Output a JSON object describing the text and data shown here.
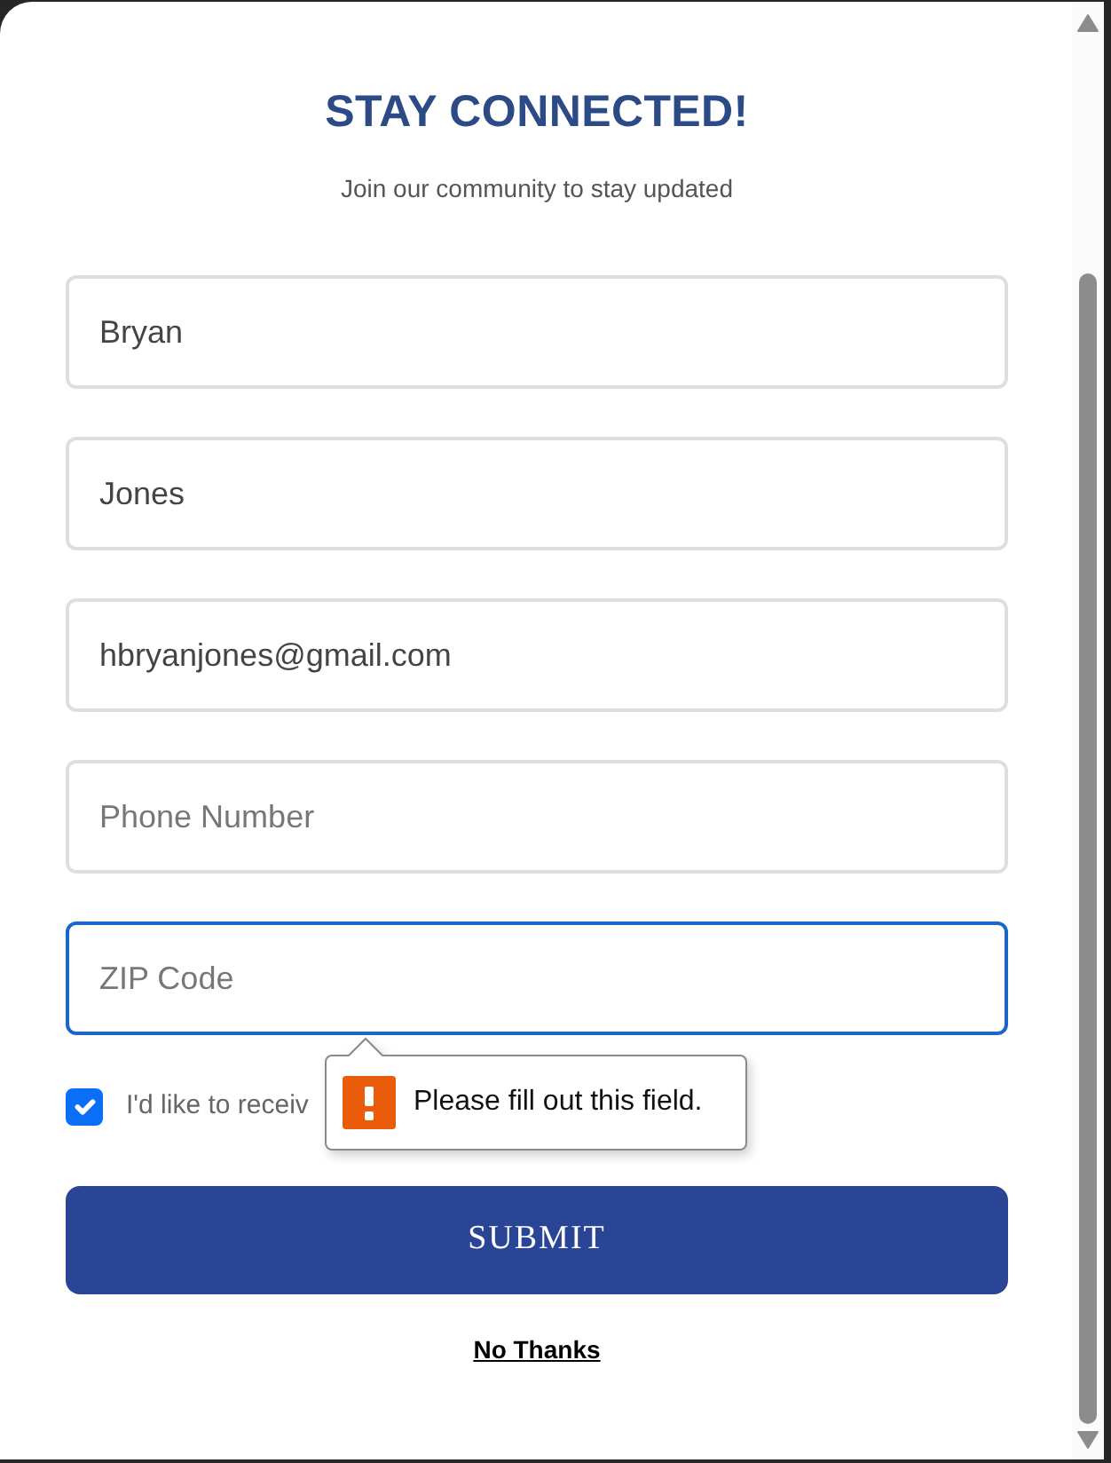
{
  "header": {
    "title": "STAY CONNECTED!",
    "subtitle": "Join our community to stay updated"
  },
  "fields": [
    {
      "value": "Bryan",
      "focused": false
    },
    {
      "value": "Jones",
      "focused": false
    },
    {
      "value": "hbryanjones@gmail.com",
      "focused": false
    },
    {
      "placeholder": "Phone Number",
      "focused": false
    },
    {
      "placeholder": "ZIP Code",
      "focused": true
    }
  ],
  "consent": {
    "label": "I'd like to receiv",
    "checked": true
  },
  "tooltip": {
    "message": "Please fill out this field."
  },
  "actions": {
    "submit": "SUBMIT",
    "decline": "No Thanks"
  }
}
